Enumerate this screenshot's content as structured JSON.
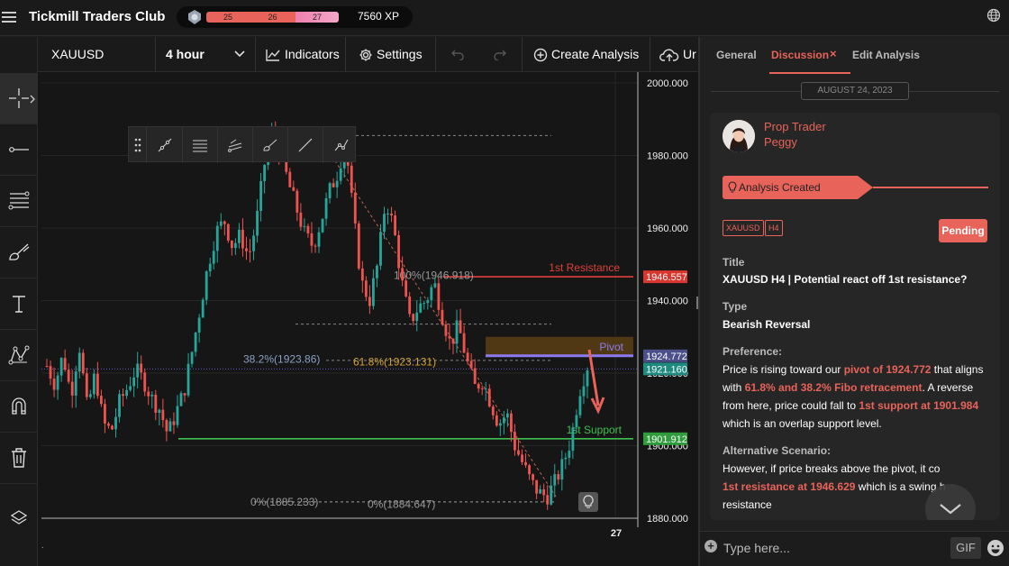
{
  "app": {
    "brand": "Tickmill Traders Club",
    "xp_segments": [
      "25",
      "26",
      "27"
    ],
    "xp": "7560 XP"
  },
  "toolbar": {
    "symbol": "XAUUSD",
    "interval": "4 hour",
    "indicators": "Indicators",
    "settings": "Settings",
    "create": "Create Analysis",
    "cut_label": "Ur"
  },
  "chart_data": {
    "type": "candlestick",
    "symbol": "XAUUSD",
    "interval": "4 hour",
    "ylim": [
      1880,
      2000
    ],
    "y_ticks": [
      "2000.000",
      "1980.000",
      "1960.000",
      "1940.000",
      "1920.000",
      "1900.000",
      "1880.000"
    ],
    "x_ticks": [
      "27"
    ],
    "path": [
      1922,
      1917,
      1925,
      1914,
      1928,
      1910,
      1920,
      1906,
      1904,
      1912,
      1916,
      1921,
      1918,
      1913,
      1910,
      1903,
      1909,
      1915,
      1926,
      1938,
      1950,
      1959,
      1962,
      1955,
      1958,
      1952,
      1962,
      1978,
      1986,
      1980,
      1972,
      1965,
      1958,
      1955,
      1962,
      1970,
      1975,
      1984,
      1963,
      1945,
      1940,
      1950,
      1968,
      1960,
      1945,
      1934,
      1938,
      1940,
      1945,
      1936,
      1928,
      1933,
      1924,
      1916,
      1918,
      1912,
      1906,
      1909,
      1900,
      1895,
      1890,
      1887,
      1886,
      1890,
      1895,
      1902,
      1915,
      1922
    ],
    "lines": [
      {
        "label": "1st Resistance",
        "value": 1946.557,
        "price_label": "1946.557",
        "color": "#e0403a"
      },
      {
        "label": "Pivot",
        "value": 1924.772,
        "price_label": "1924.772",
        "color": "#8a7cf0"
      },
      {
        "label": "1st Support",
        "value": 1901.912,
        "price_label": "1901.912",
        "color": "#3fbf4f"
      }
    ],
    "current_price": {
      "value": 1921.16,
      "label": "1921.160"
    },
    "fib_labels": [
      {
        "text": "100%(1946.918)",
        "value": 1946.918
      },
      {
        "text": "38.2%(1923.86)",
        "value": 1923.86
      },
      {
        "text": "61.8%(1923.131)",
        "value": 1923.131
      },
      {
        "text": "0%(1885.233)",
        "value": 1885.233
      },
      {
        "text": "0%(1884.647)",
        "value": 1884.647
      }
    ],
    "zone": [
      1925,
      1930
    ]
  },
  "panel": {
    "tabs": [
      "General",
      "Discussion",
      "Edit Analysis"
    ],
    "date": "AUGUST 24, 2023",
    "author_role": "Prop Trader",
    "author_name": "Peggy",
    "created_label": "Analysis Created",
    "tags": [
      "XAUUSD",
      "H4"
    ],
    "status": "Pending",
    "title_label": "Title",
    "title": "XAUUSD H4 | Potential react off 1st resistance?",
    "type_label": "Type",
    "type": "Bearish Reversal",
    "pref_label": "Preference:",
    "pref_1": "Price is rising toward our ",
    "pref_hl1": "pivot of 1924.772",
    "pref_2": " that aligns with ",
    "pref_hl2": "61.8% and 38.2% Fibo retracement",
    "pref_3": ". A reverse from here, price could fall to ",
    "pref_hl3": "1st support at 1901.984",
    "pref_4": " which is an overlap support level.",
    "alt_label": "Alternative Scenario:",
    "alt_1": "However, if price breaks above the pivot, it co",
    "alt_hl": "1st resistance at 1946.629",
    "alt_2": " which is a swing h",
    "alt_3": "resistance",
    "placeholder": "Type here...",
    "gif": "GIF"
  },
  "colors": {
    "accent": "#e8635a",
    "bull": "#26a69a",
    "bear": "#ef5350"
  }
}
